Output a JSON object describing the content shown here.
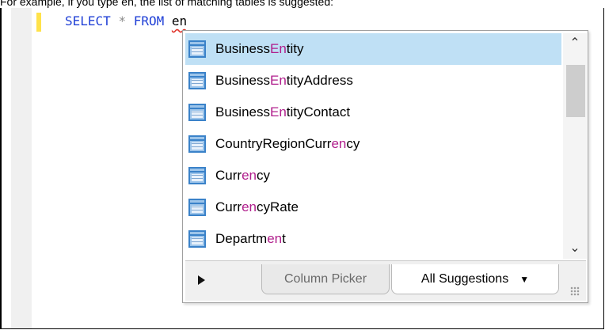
{
  "caption": "For example, if you type en, the list of matching tables is suggested:",
  "editor": {
    "keyword_select": "SELECT",
    "operator_star": "*",
    "keyword_from": "FROM",
    "typed_text": "en"
  },
  "suggestions": {
    "items": [
      {
        "pre": "Business",
        "match": "En",
        "post": "tity",
        "icon": "table-icon",
        "selected": true
      },
      {
        "pre": "Business",
        "match": "En",
        "post": "tityAddress",
        "icon": "table-icon"
      },
      {
        "pre": "Business",
        "match": "En",
        "post": "tityContact",
        "icon": "table-icon"
      },
      {
        "pre": "CountryRegionCurr",
        "match": "en",
        "post": "cy",
        "icon": "table-icon"
      },
      {
        "pre": "Curr",
        "match": "en",
        "post": "cy",
        "icon": "table-icon"
      },
      {
        "pre": "Curr",
        "match": "en",
        "post": "cyRate",
        "icon": "table-icon"
      },
      {
        "pre": "Departm",
        "match": "en",
        "post": "t",
        "icon": "table-icon"
      }
    ],
    "scroll_up_icon": "chevron-up-icon",
    "scroll_down_icon": "chevron-down-icon"
  },
  "footer": {
    "expand_icon": "play-icon",
    "tab_column_picker": "Column Picker",
    "tab_all_suggestions": "All Suggestions",
    "dropdown_icon": "caret-down-icon",
    "resize_icon": "resize-grip-icon"
  },
  "colors": {
    "keyword": "#1f3fd6",
    "match_highlight": "#b01e8c",
    "selection": "#bfe0f5",
    "change_marker": "#ffe24a"
  }
}
